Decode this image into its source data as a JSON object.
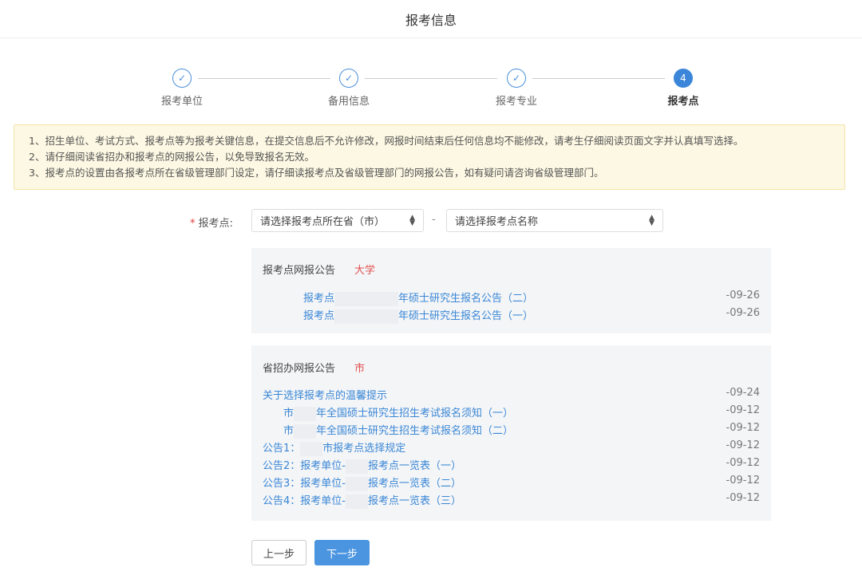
{
  "header": {
    "title": "报考信息"
  },
  "steps": [
    {
      "label": "报考单位",
      "state": "done",
      "icon": "check-icon"
    },
    {
      "label": "备用信息",
      "state": "done",
      "icon": "check-icon"
    },
    {
      "label": "报考专业",
      "state": "done",
      "icon": "check-icon"
    },
    {
      "label": "报考点",
      "state": "active",
      "number": "4"
    }
  ],
  "notice": {
    "lines": [
      "1、招生单位、考试方式、报考点等为报考关键信息，在提交信息后不允许修改，网报时间结束后任何信息均不能修改，请考生仔细阅读页面文字并认真填写选择。",
      "2、请仔细阅读省招办和报考点的网报公告，以免导致报名无效。",
      "3、报考点的设置由各报考点所在省级管理部门设定，请仔细读报考点及省级管理部门的网报公告，如有疑问请咨询省级管理部门。"
    ]
  },
  "form": {
    "required_mark": "*",
    "label": "报考点:",
    "province_select": "请选择报考点所在省（市）",
    "separator": "-",
    "site_select": "请选择报考点名称"
  },
  "site_panel": {
    "title": "报考点网报公告",
    "title_highlight": "大学",
    "items": [
      {
        "prefix": "报考点",
        "text": "年硕士研究生报名公告（二）",
        "date": "-09-26"
      },
      {
        "prefix": "报考点",
        "text": "年硕士研究生报名公告（一）",
        "date": "-09-26"
      }
    ]
  },
  "province_panel": {
    "title": "省招办网报公告",
    "title_highlight": "市",
    "items": [
      {
        "text": "关于选择报考点的温馨提示",
        "date": "-09-24"
      },
      {
        "prefix": "市",
        "text": "年全国硕士研究生招生考试报名须知（一）",
        "date": "-09-12"
      },
      {
        "prefix": "市",
        "text": "年全国硕士研究生招生考试报名须知（二）",
        "date": "-09-12"
      },
      {
        "prefix": "公告1：",
        "text": "市报考点选择规定",
        "date": "-09-12"
      },
      {
        "prefix": "公告2：报考单位-",
        "text": "报考点一览表（一）",
        "date": "-09-12"
      },
      {
        "prefix": "公告3：报考单位-",
        "text": "报考点一览表（二）",
        "date": "-09-12"
      },
      {
        "prefix": "公告4：报考单位-",
        "text": "报考点一览表（三）",
        "date": "-09-12"
      }
    ]
  },
  "buttons": {
    "prev": "上一步",
    "next": "下一步"
  },
  "colors": {
    "accent": "#3b86d8",
    "link": "#3a87d6",
    "notice_bg": "#fdf8e3",
    "required": "#e23b3b"
  }
}
